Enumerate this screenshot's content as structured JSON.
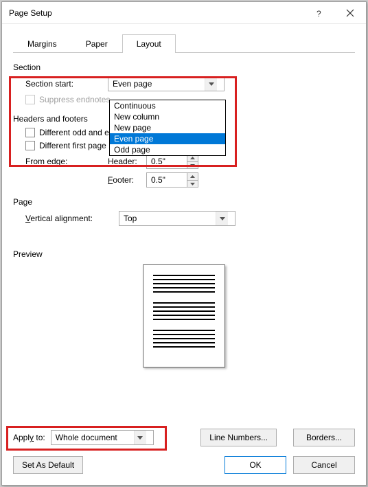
{
  "title": "Page Setup",
  "tabs": {
    "margins": "Margins",
    "paper": "Paper",
    "layout": "Layout"
  },
  "section": {
    "label": "Section",
    "start_label": "Section start:",
    "start_value": "Even page",
    "suppress_label": "Suppress endnotes",
    "options": [
      "Continuous",
      "New column",
      "New page",
      "Even page",
      "Odd page"
    ]
  },
  "headers": {
    "label": "Headers and footers",
    "diff_odd_label": "Different odd and even",
    "diff_first_label": "Different first page",
    "from_edge_label": "From edge:",
    "header_label": "Header:",
    "header_value": "0.5\"",
    "footer_label": "Footer:",
    "footer_value": "0.5\""
  },
  "page": {
    "label": "Page",
    "valign_label": "Vertical alignment:",
    "valign_value": "Top"
  },
  "preview_label": "Preview",
  "apply": {
    "label": "Apply to:",
    "value": "Whole document"
  },
  "buttons": {
    "line_numbers": "Line Numbers...",
    "borders": "Borders...",
    "set_default": "Set As Default",
    "ok": "OK",
    "cancel": "Cancel"
  }
}
